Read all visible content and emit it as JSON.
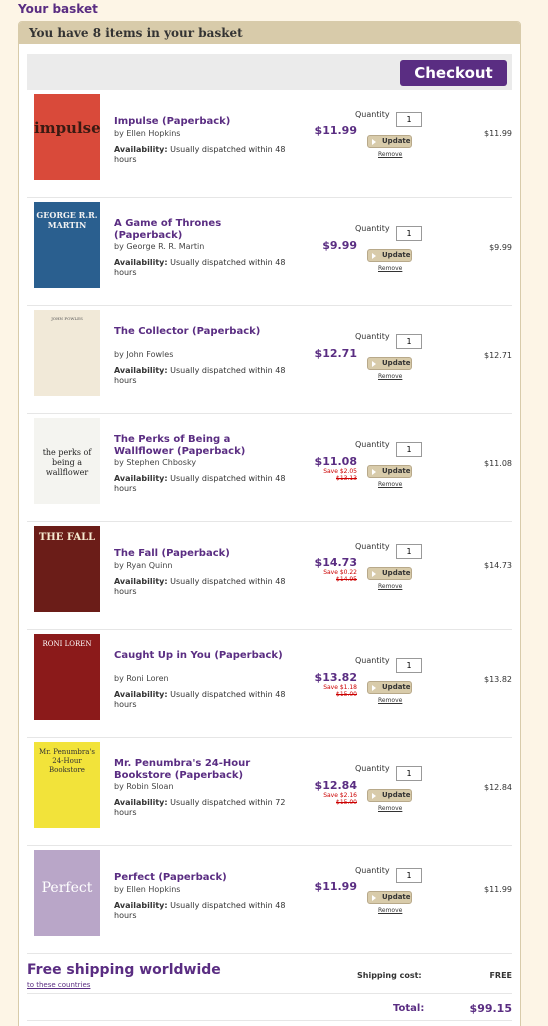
{
  "page_heading": "Your basket",
  "basket_summary": "You have 8 items in your basket",
  "checkout_label": "Checkout",
  "labels": {
    "availability": "Availability:",
    "quantity": "Quantity",
    "update": "Update",
    "remove": "Remove"
  },
  "items": [
    {
      "title": "Impulse (Paperback)",
      "author": "by Ellen Hopkins",
      "availability": "Usually dispatched within 48 hours",
      "price": "$11.99",
      "save": "",
      "old_price": "",
      "quantity": "1",
      "line_total": "$11.99",
      "cover_text": "impulse",
      "cover_color": "#d94a3a"
    },
    {
      "title": "A Game of Thrones (Paperback)",
      "author": "by George R. R. Martin",
      "availability": "Usually dispatched within 48 hours",
      "price": "$9.99",
      "save": "",
      "old_price": "",
      "quantity": "1",
      "line_total": "$9.99",
      "cover_text": "GEORGE R.R. MARTIN",
      "cover_color": "#2a5f8f"
    },
    {
      "title": "The Collector (Paperback)",
      "author": "by John Fowles",
      "availability": "Usually dispatched within 48 hours",
      "price": "$12.71",
      "save": "",
      "old_price": "",
      "quantity": "1",
      "line_total": "$12.71",
      "cover_text": "JOHN FOWLES",
      "cover_color": "#f1e9d8"
    },
    {
      "title": "The Perks of Being a Wallflower (Paperback)",
      "author": "by Stephen Chbosky",
      "availability": "Usually dispatched within 48 hours",
      "price": "$11.08",
      "save": "Save $2.05",
      "old_price": "$13.13",
      "quantity": "1",
      "line_total": "$11.08",
      "cover_text": "the perks of being a wallflower",
      "cover_color": "#f4f4f0"
    },
    {
      "title": "The Fall (Paperback)",
      "author": "by Ryan Quinn",
      "availability": "Usually dispatched within 48 hours",
      "price": "$14.73",
      "save": "Save $0.22",
      "old_price": "$14.95",
      "quantity": "1",
      "line_total": "$14.73",
      "cover_text": "THE FALL",
      "cover_color": "#6b1d18"
    },
    {
      "title": "Caught Up in You (Paperback)",
      "author": "by Roni Loren",
      "availability": "Usually dispatched within 48 hours",
      "price": "$13.82",
      "save": "Save $1.18",
      "old_price": "$15.00",
      "quantity": "1",
      "line_total": "$13.82",
      "cover_text": "RONI LOREN",
      "cover_color": "#8b1a1a"
    },
    {
      "title": "Mr. Penumbra's 24-Hour Bookstore (Paperback)",
      "author": "by Robin Sloan",
      "availability": "Usually dispatched within 72 hours",
      "price": "$12.84",
      "save": "Save $2.16",
      "old_price": "$15.00",
      "quantity": "1",
      "line_total": "$12.84",
      "cover_text": "Mr. Penumbra's 24-Hour Bookstore",
      "cover_color": "#f2e33a"
    },
    {
      "title": "Perfect (Paperback)",
      "author": "by Ellen Hopkins",
      "availability": "Usually dispatched within 48 hours",
      "price": "$11.99",
      "save": "",
      "old_price": "",
      "quantity": "1",
      "line_total": "$11.99",
      "cover_text": "Perfect",
      "cover_color": "#b9a6c8"
    }
  ],
  "shipping": {
    "free_label": "Free shipping worldwide",
    "link_label": "to these countries",
    "cost_label": "Shipping cost:",
    "cost_value": "FREE"
  },
  "total": {
    "label": "Total:",
    "value": "$99.15"
  },
  "colors": {
    "brand": "#5a2d82",
    "sale": "#cc0000",
    "panel_header": "#d8cbaa",
    "page_bg": "#fdf5e6"
  }
}
